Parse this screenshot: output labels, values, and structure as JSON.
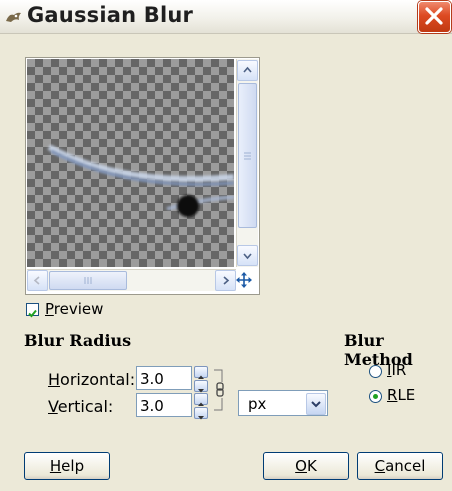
{
  "window": {
    "title": "Gaussian Blur",
    "title_icon": "gimp-wilber-icon",
    "close_icon": "close-x-icon"
  },
  "preview": {
    "label_accesskey": "P",
    "label_rest": "review",
    "checked": true,
    "nav_icon": "move-cross-arrows-icon"
  },
  "blur_radius": {
    "title": "Blur Radius",
    "horizontal": {
      "label_accesskey": "H",
      "label_rest": "orizontal:",
      "value": "3.0"
    },
    "vertical": {
      "label_accesskey": "V",
      "label_rest": "ertical:",
      "value": "3.0"
    },
    "chain_icon": "chain-link-icon",
    "unit": "px"
  },
  "blur_method": {
    "title": "Blur Method",
    "options": [
      {
        "accesskey": "I",
        "label_rest": "IR",
        "selected": false
      },
      {
        "accesskey": "R",
        "label_rest": "LE",
        "selected": true
      }
    ]
  },
  "buttons": {
    "help": {
      "accesskey": "H",
      "label_rest": "elp"
    },
    "ok": {
      "accesskey": "O",
      "label_rest": "K"
    },
    "cancel": {
      "accesskey": "C",
      "label_rest": "ancel"
    }
  },
  "colors": {
    "titlebar": "#f2f1ea",
    "close_button": "#dd4a22",
    "dialog_bg": "#ece9d8",
    "radio_selected": "#21a121",
    "checkmark": "#21a121"
  }
}
